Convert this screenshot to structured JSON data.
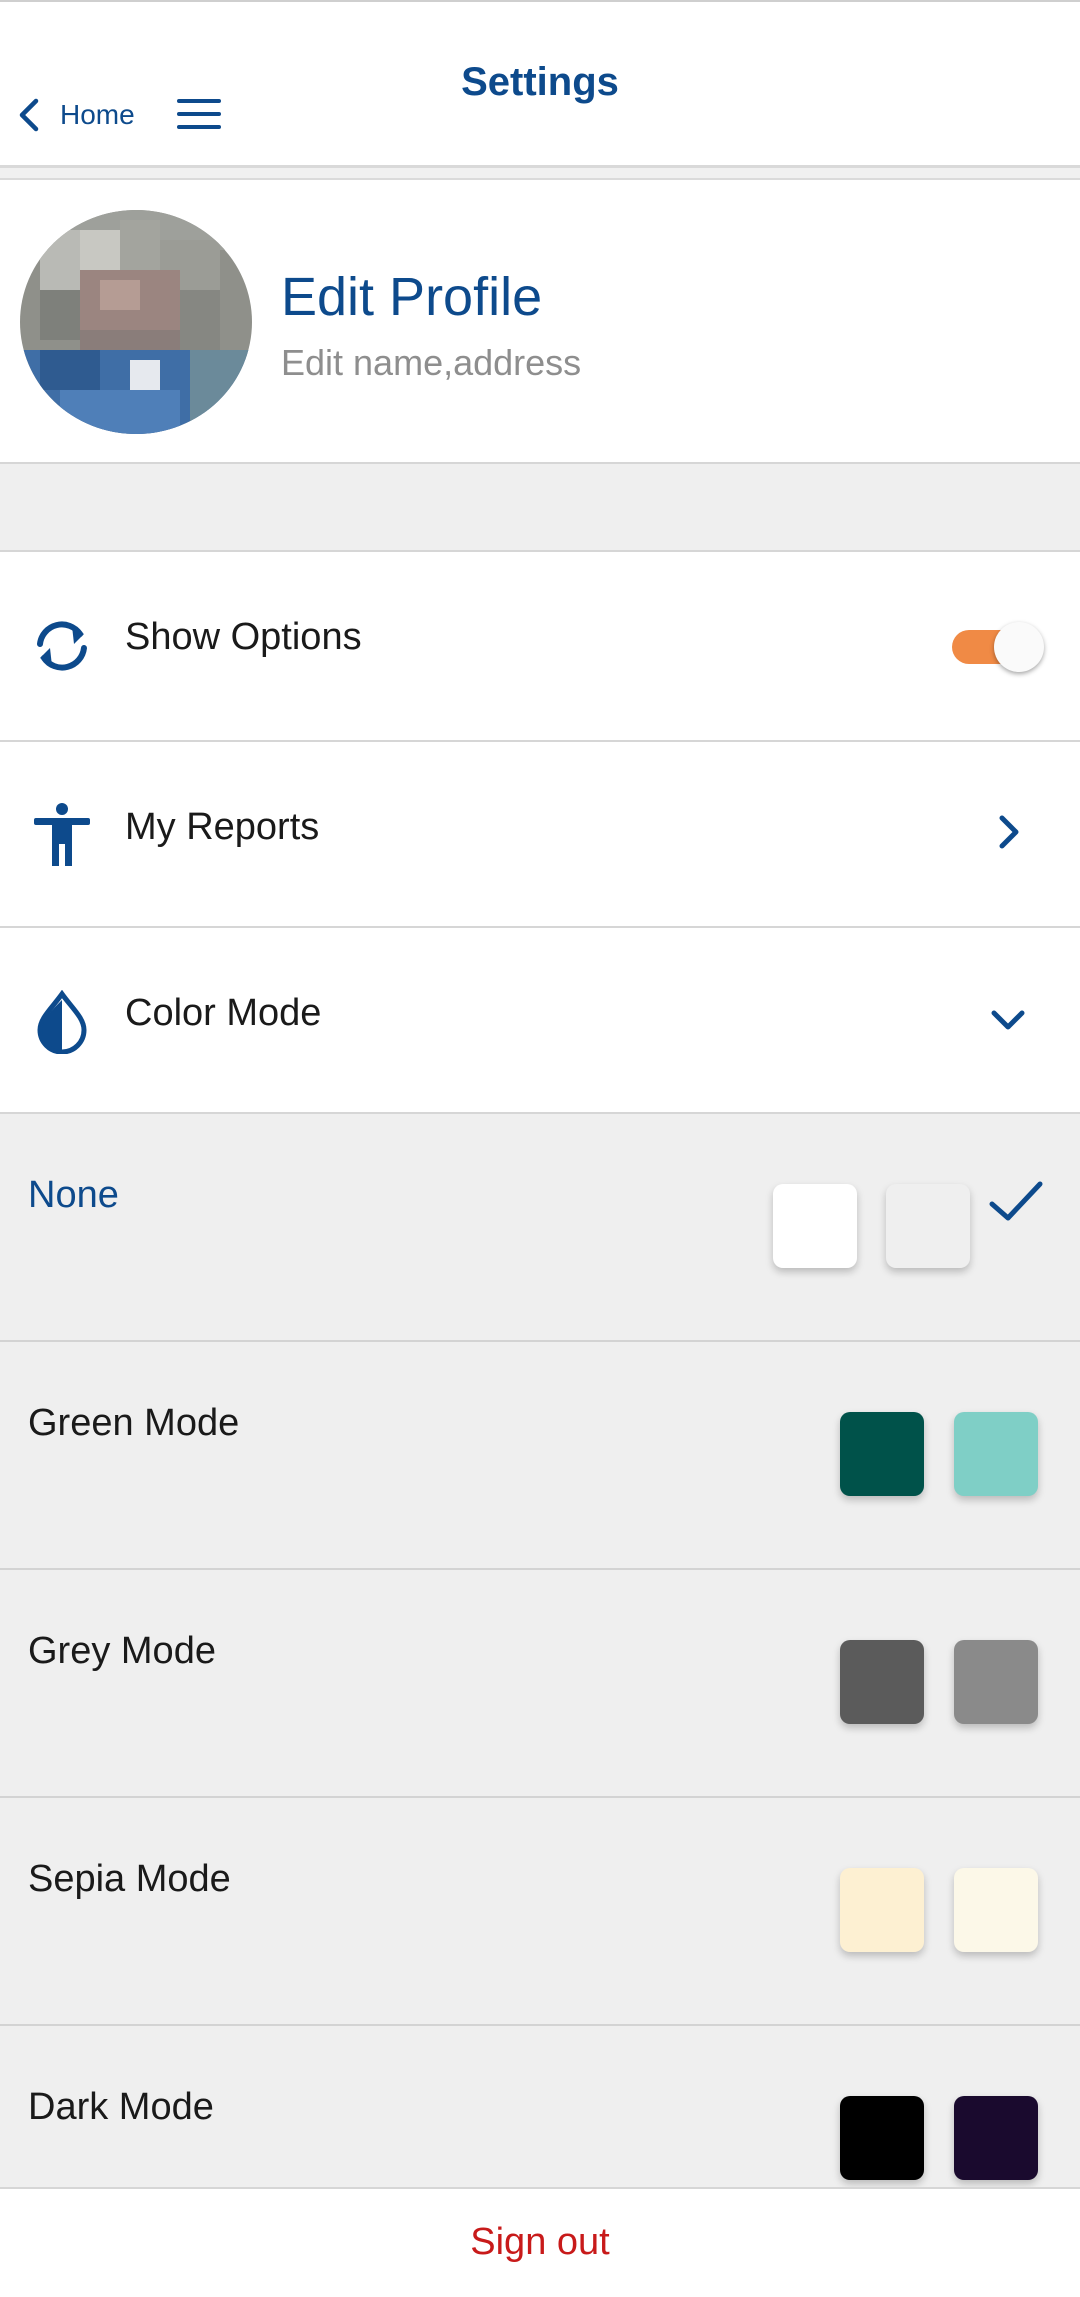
{
  "header": {
    "back_label": "Home",
    "title": "Settings",
    "back_icon": "chevron-left-icon",
    "menu_icon": "hamburger-menu-icon"
  },
  "profile": {
    "title": "Edit Profile",
    "subtitle": "Edit name,address"
  },
  "settings": {
    "show_options": {
      "label": "Show Options",
      "icon": "sync-icon",
      "toggle_on": true
    },
    "my_reports": {
      "label": "My Reports",
      "icon": "person-icon"
    },
    "color_mode": {
      "label": "Color Mode",
      "icon": "water-drop-icon",
      "expanded": true
    }
  },
  "color_modes": [
    {
      "label": "None",
      "selected": true,
      "colors": [
        "#ffffff",
        "#efefef"
      ]
    },
    {
      "label": "Green Mode",
      "selected": false,
      "colors": [
        "#00524a",
        "#7fcfc6"
      ]
    },
    {
      "label": "Grey Mode",
      "selected": false,
      "colors": [
        "#5b5b5b",
        "#8a8a8a"
      ]
    },
    {
      "label": "Sepia Mode",
      "selected": false,
      "colors": [
        "#fdf0d2",
        "#fcf8e8"
      ]
    },
    {
      "label": "Dark Mode",
      "selected": false,
      "colors": [
        "#000000",
        "#1a0a2e"
      ]
    }
  ],
  "footer": {
    "signout_label": "Sign out"
  },
  "theme": {
    "accent": "#0d4a8c",
    "toggle_on_color": "#f08a45",
    "signout_color": "#c81a1a"
  }
}
